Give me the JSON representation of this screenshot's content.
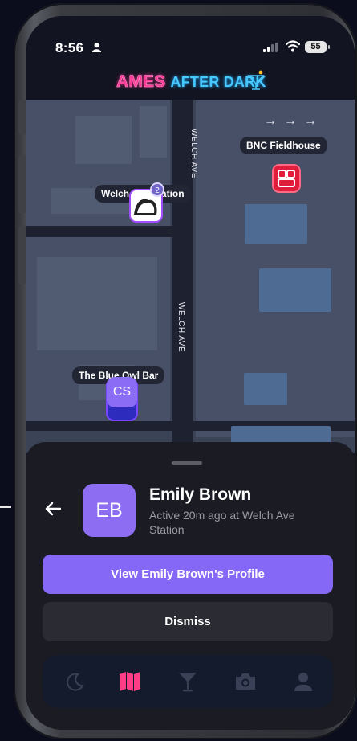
{
  "status_bar": {
    "time": "8:56",
    "battery": "55"
  },
  "header": {
    "logo_ames": "AMES",
    "logo_after_dark": "AFTER DARK"
  },
  "map": {
    "streets": [
      "WELCH AVE",
      "WELCH AVE"
    ],
    "places": [
      {
        "label": "BNC Fieldhouse"
      },
      {
        "label": "Welch Ave Station",
        "cluster_count": "2"
      },
      {
        "label": "The Blue Owl Bar",
        "avatar_initials": "CS"
      }
    ]
  },
  "sheet": {
    "user": {
      "initials": "EB",
      "name": "Emily Brown",
      "status": "Active 20m ago at Welch Ave Station"
    },
    "primary_button": "View Emily Brown's Profile",
    "secondary_button": "Dismiss"
  },
  "tabbar": {
    "tabs": [
      {
        "icon": "moon-icon",
        "active": false
      },
      {
        "icon": "map-icon",
        "active": true
      },
      {
        "icon": "cocktail-icon",
        "active": false
      },
      {
        "icon": "camera-icon",
        "active": false
      },
      {
        "icon": "person-icon",
        "active": false
      }
    ],
    "active_color": "#ff3d86",
    "inactive_color": "#3a4156"
  },
  "colors": {
    "accent": "#8668f6",
    "background": "#0b0d1c"
  }
}
